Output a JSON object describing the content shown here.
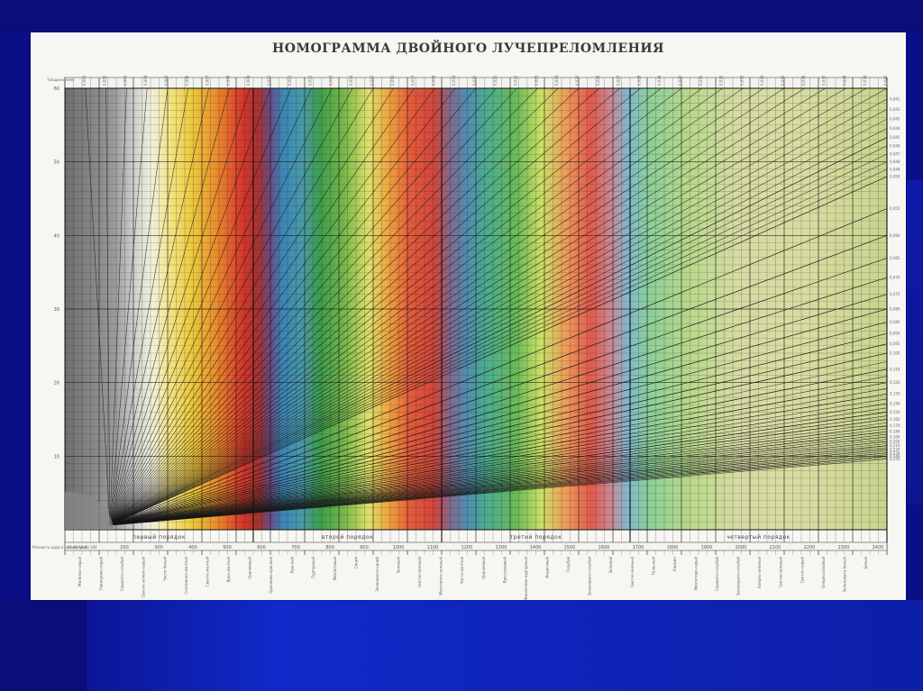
{
  "page": {
    "title": "НОМОГРАММА ДВОЙНОГО ЛУЧЕПРЕЛОМЛЕНИЯ",
    "colors": {
      "background": "#0b0f86",
      "sheet": "#f7f6f3",
      "grid": "#2a2a2a"
    }
  },
  "chart_data": {
    "type": "nomogram",
    "title": "НОМОГРАММА ДВОЙНОГО ЛУЧЕПРЕЛОМЛЕНИЯ",
    "x_axis": {
      "label": "Разность хода в нанометрах",
      "range": [
        0,
        2400
      ],
      "ticks": [
        100,
        200,
        300,
        400,
        500,
        600,
        700,
        800,
        900,
        1000,
        1100,
        1200,
        1300,
        1400,
        1500,
        1600,
        1700,
        1800,
        1900,
        2000,
        2100,
        2200,
        2300,
        2400
      ],
      "first_tick_label": "25 40 60 80 100"
    },
    "y_axis": {
      "label": "Толщина, мкм",
      "range": [
        0,
        60
      ],
      "ticks": [
        10,
        20,
        30,
        40,
        50,
        60
      ]
    },
    "orders": [
      {
        "name": "первый порядок",
        "range": [
          0,
          550
        ]
      },
      {
        "name": "второй порядок",
        "range": [
          550,
          1100
        ]
      },
      {
        "name": "третий порядок",
        "range": [
          1100,
          1650
        ]
      },
      {
        "name": "четвертый порядок",
        "range": [
          1650,
          2400
        ]
      }
    ],
    "birefringence_lines_top_labels": [
      "0,001",
      "0,002",
      "0,003",
      "0,004",
      "0,005",
      "0,006",
      "0,007",
      "0,008",
      "0,009",
      "0,010",
      "0,011",
      "0,012",
      "0,013",
      "0,014",
      "0,015",
      "0,016",
      "0,017",
      "0,018",
      "0,019",
      "0,020",
      "0,021",
      "0,022",
      "0,023",
      "0,024",
      "0,025",
      "0,026",
      "0,027",
      "0,028",
      "0,029",
      "0,030",
      "0,031",
      "0,032",
      "0,033",
      "0,034",
      "0,035",
      "0,036",
      "0,037",
      "0,038",
      "0,039",
      "0,040"
    ],
    "right_axis_labels": [
      "0,041",
      "0,042",
      "0,043",
      "0,044",
      "0,045",
      "0,046",
      "0,047",
      "0,048",
      "0,049",
      "0,050",
      "0,055",
      "0,060",
      "0,065",
      "0,070",
      "0,075",
      "0,080",
      "0,085",
      "0,090",
      "0,095",
      "0,100",
      "0,110",
      "0,120",
      "0,130",
      "0,140",
      "0,150",
      "0,160",
      "0,170",
      "0,180",
      "0,190",
      "0,200",
      "0,210",
      "0,220",
      "0,230",
      "0,240",
      "0,250"
    ],
    "color_labels": [
      "Железно-серый",
      "Лавандово-серый",
      "Серовато-голубой",
      "Светло-зелено-серый",
      "Чисто белый",
      "Соломенно-желтый",
      "Светло-желтый",
      "Ярко-желтый",
      "Оранжевый",
      "Оранжево-красный",
      "Красный",
      "Пурпурный",
      "Фиолетовый",
      "Синий",
      "Зеленовато-синий",
      "Зеленый",
      "Светло-зеленый",
      "Желтовато-зеленый",
      "Чисто желтый",
      "Оранжевый",
      "Ярко-розовый",
      "Фиолетово-пурпурный",
      "Индиговый",
      "Голубой",
      "Зеленовато-голубой",
      "Зеленый",
      "Светло-зеленый",
      "Телесный",
      "Кармин",
      "Фиолетово-серый",
      "Серовато-голубой",
      "Зеленовато-голубой",
      "Бледно-зеленый",
      "Светло-зеленый",
      "Светло-серый",
      "Бледно-розовый",
      "Зеленовато-белый",
      "Белый"
    ]
  }
}
